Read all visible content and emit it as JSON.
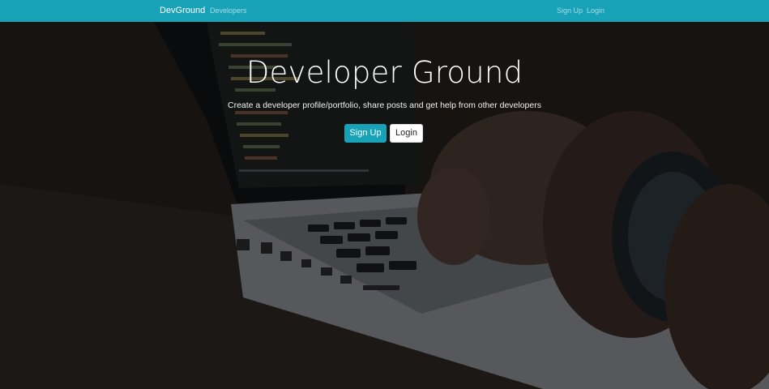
{
  "navbar": {
    "brand": "DevGround",
    "links": {
      "developers": "Developers",
      "sign_up": "Sign Up",
      "login": "Login"
    }
  },
  "hero": {
    "title": "Developer Ground",
    "lead": "Create a developer profile/portfolio, share posts and get help from other developers",
    "buttons": {
      "sign_up": "Sign Up",
      "login": "Login"
    }
  },
  "colors": {
    "accent": "#17a2b8",
    "overlay": "rgba(0,0,0,0.38)"
  }
}
